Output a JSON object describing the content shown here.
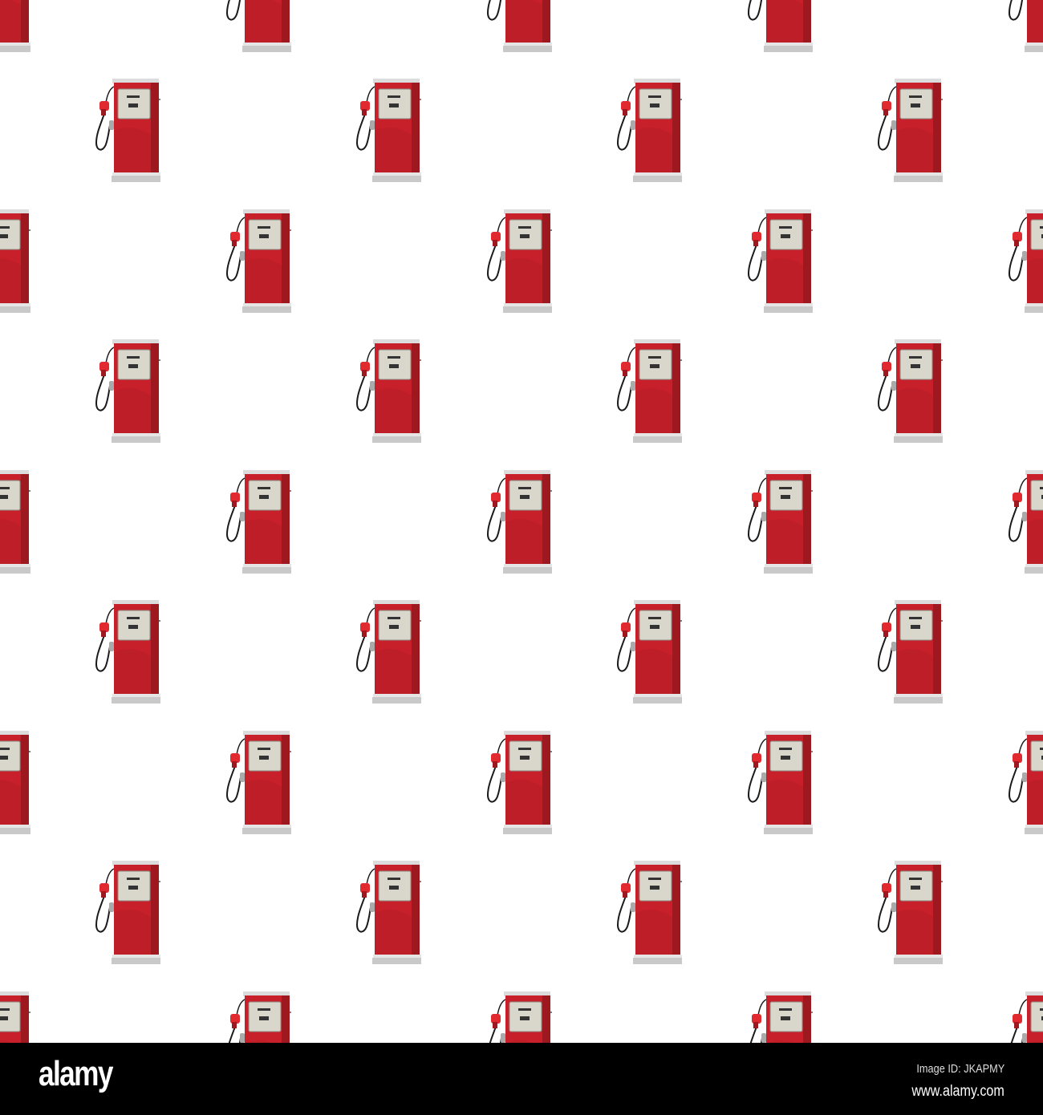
{
  "pattern": {
    "subject": "gas-pump",
    "colors": {
      "body": "#c8202a",
      "body_shade": "#9e1820",
      "panel": "#d9d6cc",
      "base": "#c9c9c9",
      "hose": "#1a1a1a",
      "background": "#ffffff"
    }
  },
  "watermark": {
    "logo": "alamy",
    "image_id": "Image ID: JKAPMY",
    "site": "www.alamy.com"
  }
}
